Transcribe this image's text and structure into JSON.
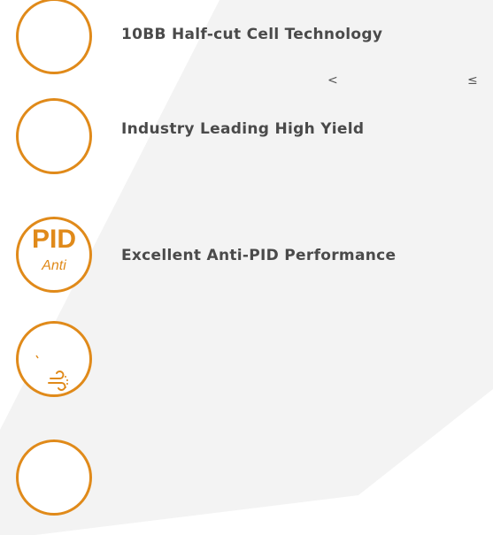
{
  "colors": {
    "accent": "#e08a1a",
    "shade": "#f3f3f3"
  },
  "features": [
    {
      "title": "10BB Half-cut Cell Technology",
      "icon": "blank-circle-icon"
    },
    {
      "title": "Industry Leading High Yield",
      "icon": "blank-circle-icon"
    },
    {
      "title": "Excellent Anti-PID Performance",
      "icon": "pid-anti-icon",
      "icon_text": "PID",
      "icon_subtext": "Anti"
    },
    {
      "title": "",
      "icon": "wind-load-icon"
    },
    {
      "title": "",
      "icon": "blank-circle-icon"
    }
  ],
  "symbols": {
    "less_than": "<",
    "less_equal": "≤"
  }
}
